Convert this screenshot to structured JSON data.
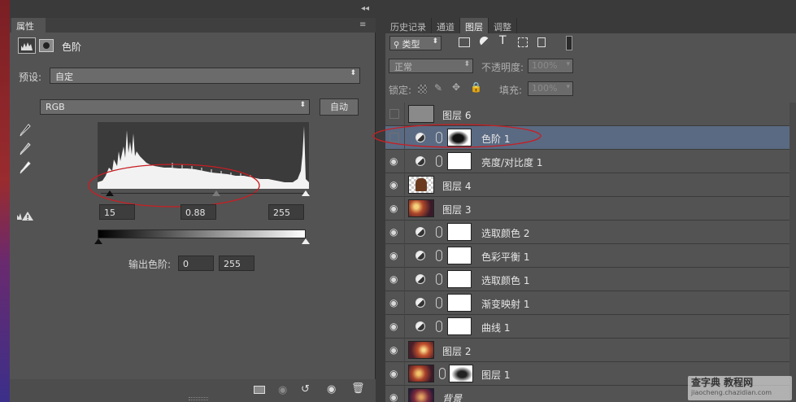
{
  "props_panel": {
    "tab_label": "属性",
    "title": "色阶",
    "preset_label": "预设:",
    "preset_value": "自定",
    "channel_value": "RGB",
    "auto_button": "自动",
    "input_black": "15",
    "input_gamma": "0.88",
    "input_white": "255",
    "output_label": "输出色阶:",
    "output_black": "0",
    "output_white": "255"
  },
  "layers_panel": {
    "tabs": [
      {
        "label": "历史记录",
        "active": false
      },
      {
        "label": "通道",
        "active": false
      },
      {
        "label": "图层",
        "active": true
      },
      {
        "label": "调整",
        "active": false
      }
    ],
    "filter_kind": "类型",
    "blend_mode": "正常",
    "opacity_label": "不透明度:",
    "opacity_value": "100%",
    "lock_label": "锁定:",
    "fill_label": "填充:",
    "fill_value": "100%",
    "layers": [
      {
        "name": "图层 6",
        "visible": false,
        "kind": "pixel"
      },
      {
        "name": "色阶 1",
        "visible": false,
        "kind": "adjustment",
        "selected": true
      },
      {
        "name": "亮度/对比度 1",
        "visible": true,
        "kind": "adjustment"
      },
      {
        "name": "图层 4",
        "visible": true,
        "kind": "pixel"
      },
      {
        "name": "图层 3",
        "visible": true,
        "kind": "pixel"
      },
      {
        "name": "选取颜色 2",
        "visible": true,
        "kind": "adjustment"
      },
      {
        "name": "色彩平衡 1",
        "visible": true,
        "kind": "adjustment"
      },
      {
        "name": "选取颜色 1",
        "visible": true,
        "kind": "adjustment"
      },
      {
        "name": "渐变映射 1",
        "visible": true,
        "kind": "adjustment"
      },
      {
        "name": "曲线 1",
        "visible": true,
        "kind": "adjustment"
      },
      {
        "name": "图层 2",
        "visible": true,
        "kind": "pixel"
      },
      {
        "name": "图层 1",
        "visible": true,
        "kind": "pixel-mask"
      },
      {
        "name": "背景",
        "visible": true,
        "kind": "background"
      }
    ]
  },
  "watermark": {
    "line1": "查字典 教程网",
    "line2": "jiaocheng.chazidian.com"
  }
}
